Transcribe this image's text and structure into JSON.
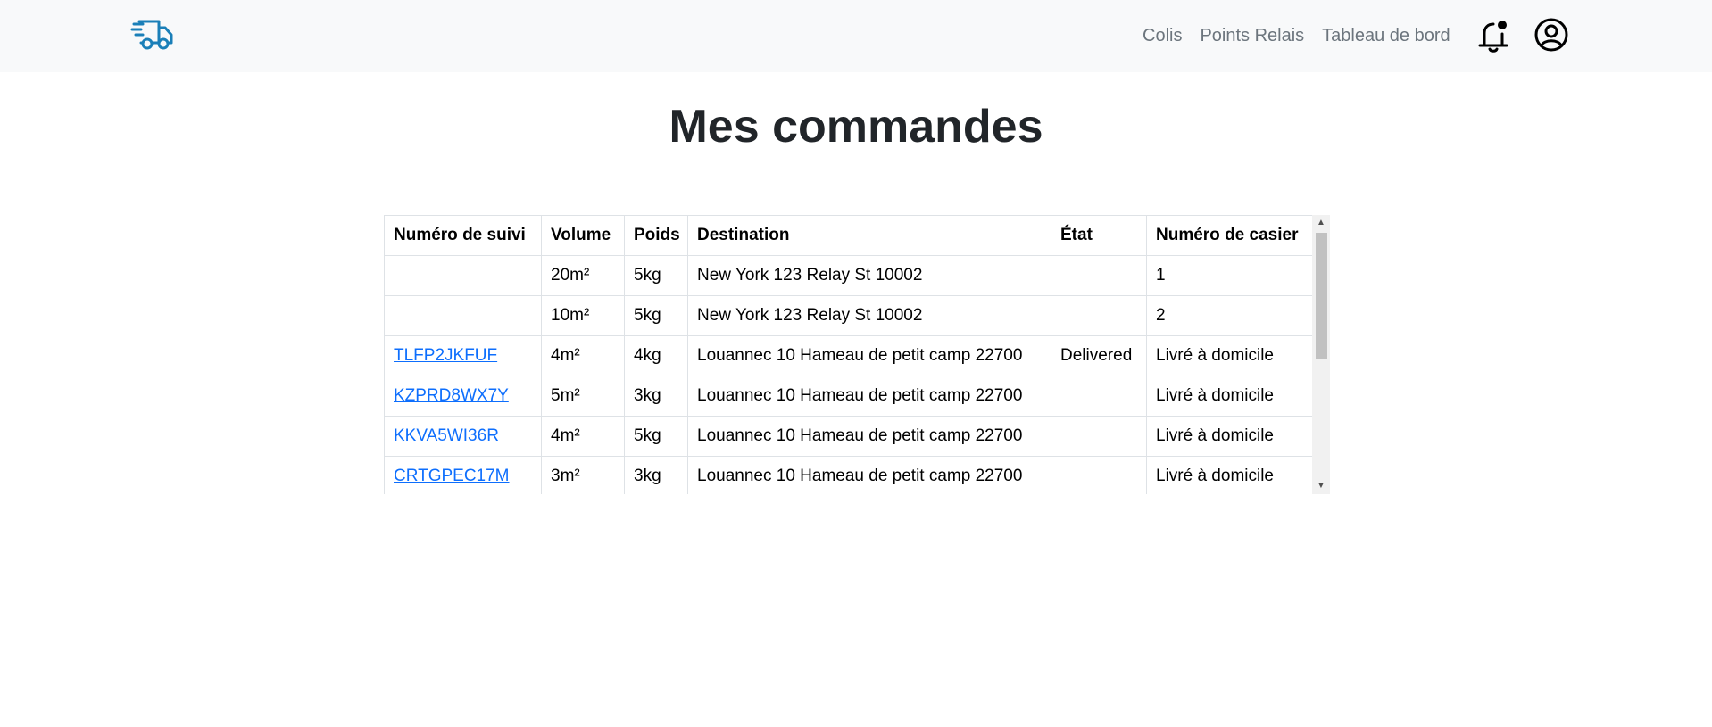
{
  "navbar": {
    "brand_icon": "delivery-truck-icon",
    "brand_color": "#1a7fb8",
    "links": [
      {
        "label": "Colis"
      },
      {
        "label": "Points Relais"
      },
      {
        "label": "Tableau de bord"
      }
    ],
    "notification_icon": "bell-icon",
    "account_icon": "user-circle-icon"
  },
  "page": {
    "title": "Mes commandes"
  },
  "orders_table": {
    "headers": [
      "Numéro de suivi",
      "Volume",
      "Poids",
      "Destination",
      "État",
      "Numéro de casier"
    ],
    "rows": [
      {
        "tracking": "",
        "volume": "20m²",
        "weight": "5kg",
        "destination": "New York 123 Relay St 10002",
        "state": "",
        "locker": "1"
      },
      {
        "tracking": "",
        "volume": "10m²",
        "weight": "5kg",
        "destination": "New York 123 Relay St 10002",
        "state": "",
        "locker": "2"
      },
      {
        "tracking": "TLFP2JKFUF",
        "volume": "4m²",
        "weight": "4kg",
        "destination": "Louannec 10 Hameau de petit camp 22700",
        "state": "Delivered",
        "locker": "Livré à domicile"
      },
      {
        "tracking": "KZPRD8WX7Y",
        "volume": "5m²",
        "weight": "3kg",
        "destination": "Louannec 10 Hameau de petit camp 22700",
        "state": "",
        "locker": "Livré à domicile"
      },
      {
        "tracking": "KKVA5WI36R",
        "volume": "4m²",
        "weight": "5kg",
        "destination": "Louannec 10 Hameau de petit camp 22700",
        "state": "",
        "locker": "Livré à domicile"
      },
      {
        "tracking": "CRTGPEC17M",
        "volume": "3m²",
        "weight": "3kg",
        "destination": "Louannec 10 Hameau de petit camp 22700",
        "state": "",
        "locker": "Livré à domicile"
      }
    ]
  },
  "colors": {
    "link": "#0d6efd",
    "navbar_bg": "#f8f9fa",
    "nav_text": "#6c757d"
  }
}
